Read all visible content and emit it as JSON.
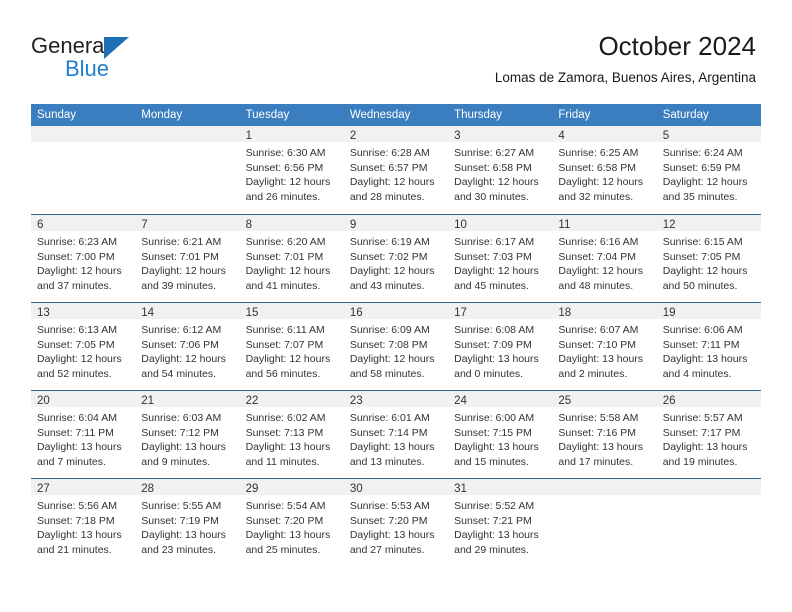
{
  "brand": {
    "word1": "General",
    "word2": "Blue",
    "triangle_color": "#1f6fb4",
    "blue_text_color": "#1f7fd0"
  },
  "header": {
    "title": "October 2024",
    "subtitle": "Lomas de Zamora, Buenos Aires, Argentina"
  },
  "theme": {
    "header_bar_color": "#3a7ec0",
    "row_divider_color": "#33658f",
    "day_band_color": "#f1f1f1",
    "text_color": "#333333"
  },
  "calendar": {
    "weekdays": [
      "Sunday",
      "Monday",
      "Tuesday",
      "Wednesday",
      "Thursday",
      "Friday",
      "Saturday"
    ],
    "weeks": [
      [
        {
          "day": "",
          "lines": []
        },
        {
          "day": "",
          "lines": []
        },
        {
          "day": "1",
          "lines": [
            "Sunrise: 6:30 AM",
            "Sunset: 6:56 PM",
            "Daylight: 12 hours",
            "and 26 minutes."
          ]
        },
        {
          "day": "2",
          "lines": [
            "Sunrise: 6:28 AM",
            "Sunset: 6:57 PM",
            "Daylight: 12 hours",
            "and 28 minutes."
          ]
        },
        {
          "day": "3",
          "lines": [
            "Sunrise: 6:27 AM",
            "Sunset: 6:58 PM",
            "Daylight: 12 hours",
            "and 30 minutes."
          ]
        },
        {
          "day": "4",
          "lines": [
            "Sunrise: 6:25 AM",
            "Sunset: 6:58 PM",
            "Daylight: 12 hours",
            "and 32 minutes."
          ]
        },
        {
          "day": "5",
          "lines": [
            "Sunrise: 6:24 AM",
            "Sunset: 6:59 PM",
            "Daylight: 12 hours",
            "and 35 minutes."
          ]
        }
      ],
      [
        {
          "day": "6",
          "lines": [
            "Sunrise: 6:23 AM",
            "Sunset: 7:00 PM",
            "Daylight: 12 hours",
            "and 37 minutes."
          ]
        },
        {
          "day": "7",
          "lines": [
            "Sunrise: 6:21 AM",
            "Sunset: 7:01 PM",
            "Daylight: 12 hours",
            "and 39 minutes."
          ]
        },
        {
          "day": "8",
          "lines": [
            "Sunrise: 6:20 AM",
            "Sunset: 7:01 PM",
            "Daylight: 12 hours",
            "and 41 minutes."
          ]
        },
        {
          "day": "9",
          "lines": [
            "Sunrise: 6:19 AM",
            "Sunset: 7:02 PM",
            "Daylight: 12 hours",
            "and 43 minutes."
          ]
        },
        {
          "day": "10",
          "lines": [
            "Sunrise: 6:17 AM",
            "Sunset: 7:03 PM",
            "Daylight: 12 hours",
            "and 45 minutes."
          ]
        },
        {
          "day": "11",
          "lines": [
            "Sunrise: 6:16 AM",
            "Sunset: 7:04 PM",
            "Daylight: 12 hours",
            "and 48 minutes."
          ]
        },
        {
          "day": "12",
          "lines": [
            "Sunrise: 6:15 AM",
            "Sunset: 7:05 PM",
            "Daylight: 12 hours",
            "and 50 minutes."
          ]
        }
      ],
      [
        {
          "day": "13",
          "lines": [
            "Sunrise: 6:13 AM",
            "Sunset: 7:05 PM",
            "Daylight: 12 hours",
            "and 52 minutes."
          ]
        },
        {
          "day": "14",
          "lines": [
            "Sunrise: 6:12 AM",
            "Sunset: 7:06 PM",
            "Daylight: 12 hours",
            "and 54 minutes."
          ]
        },
        {
          "day": "15",
          "lines": [
            "Sunrise: 6:11 AM",
            "Sunset: 7:07 PM",
            "Daylight: 12 hours",
            "and 56 minutes."
          ]
        },
        {
          "day": "16",
          "lines": [
            "Sunrise: 6:09 AM",
            "Sunset: 7:08 PM",
            "Daylight: 12 hours",
            "and 58 minutes."
          ]
        },
        {
          "day": "17",
          "lines": [
            "Sunrise: 6:08 AM",
            "Sunset: 7:09 PM",
            "Daylight: 13 hours",
            "and 0 minutes."
          ]
        },
        {
          "day": "18",
          "lines": [
            "Sunrise: 6:07 AM",
            "Sunset: 7:10 PM",
            "Daylight: 13 hours",
            "and 2 minutes."
          ]
        },
        {
          "day": "19",
          "lines": [
            "Sunrise: 6:06 AM",
            "Sunset: 7:11 PM",
            "Daylight: 13 hours",
            "and 4 minutes."
          ]
        }
      ],
      [
        {
          "day": "20",
          "lines": [
            "Sunrise: 6:04 AM",
            "Sunset: 7:11 PM",
            "Daylight: 13 hours",
            "and 7 minutes."
          ]
        },
        {
          "day": "21",
          "lines": [
            "Sunrise: 6:03 AM",
            "Sunset: 7:12 PM",
            "Daylight: 13 hours",
            "and 9 minutes."
          ]
        },
        {
          "day": "22",
          "lines": [
            "Sunrise: 6:02 AM",
            "Sunset: 7:13 PM",
            "Daylight: 13 hours",
            "and 11 minutes."
          ]
        },
        {
          "day": "23",
          "lines": [
            "Sunrise: 6:01 AM",
            "Sunset: 7:14 PM",
            "Daylight: 13 hours",
            "and 13 minutes."
          ]
        },
        {
          "day": "24",
          "lines": [
            "Sunrise: 6:00 AM",
            "Sunset: 7:15 PM",
            "Daylight: 13 hours",
            "and 15 minutes."
          ]
        },
        {
          "day": "25",
          "lines": [
            "Sunrise: 5:58 AM",
            "Sunset: 7:16 PM",
            "Daylight: 13 hours",
            "and 17 minutes."
          ]
        },
        {
          "day": "26",
          "lines": [
            "Sunrise: 5:57 AM",
            "Sunset: 7:17 PM",
            "Daylight: 13 hours",
            "and 19 minutes."
          ]
        }
      ],
      [
        {
          "day": "27",
          "lines": [
            "Sunrise: 5:56 AM",
            "Sunset: 7:18 PM",
            "Daylight: 13 hours",
            "and 21 minutes."
          ]
        },
        {
          "day": "28",
          "lines": [
            "Sunrise: 5:55 AM",
            "Sunset: 7:19 PM",
            "Daylight: 13 hours",
            "and 23 minutes."
          ]
        },
        {
          "day": "29",
          "lines": [
            "Sunrise: 5:54 AM",
            "Sunset: 7:20 PM",
            "Daylight: 13 hours",
            "and 25 minutes."
          ]
        },
        {
          "day": "30",
          "lines": [
            "Sunrise: 5:53 AM",
            "Sunset: 7:20 PM",
            "Daylight: 13 hours",
            "and 27 minutes."
          ]
        },
        {
          "day": "31",
          "lines": [
            "Sunrise: 5:52 AM",
            "Sunset: 7:21 PM",
            "Daylight: 13 hours",
            "and 29 minutes."
          ]
        },
        {
          "day": "",
          "lines": []
        },
        {
          "day": "",
          "lines": []
        }
      ]
    ]
  }
}
